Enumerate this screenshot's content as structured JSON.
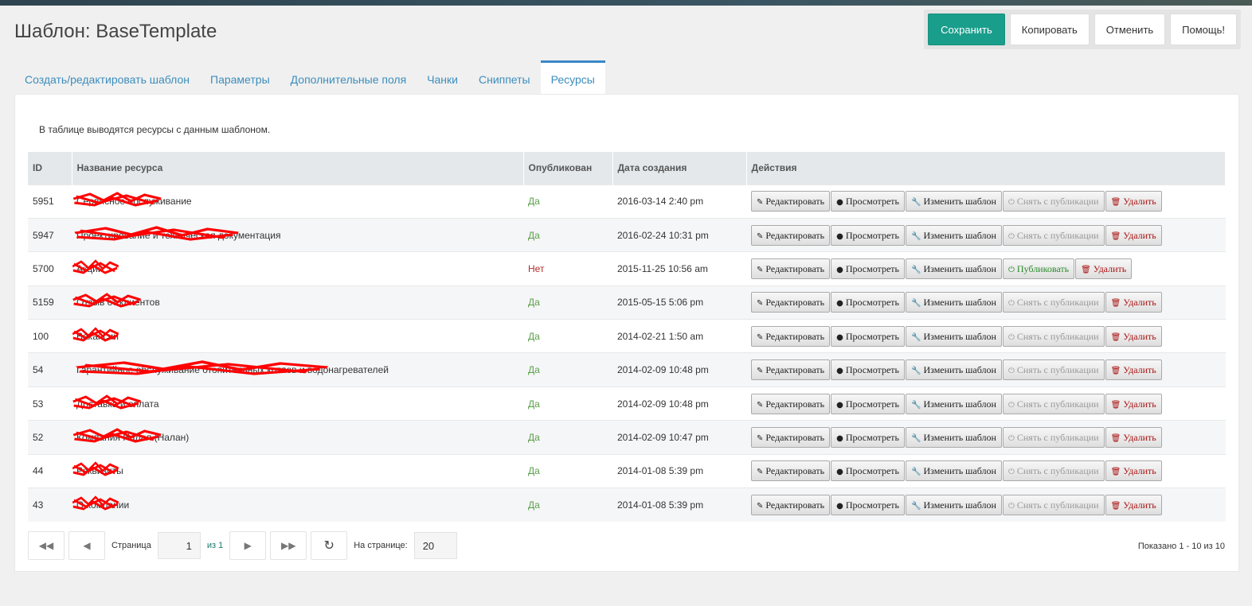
{
  "title": "Шаблон: BaseTemplate",
  "actions": {
    "save": "Сохранить",
    "copy": "Копировать",
    "cancel": "Отменить",
    "help": "Помощь!"
  },
  "tabs": [
    "Создать/редактировать шаблон",
    "Параметры",
    "Дополнительные поля",
    "Чанки",
    "Сниппеты",
    "Ресурсы"
  ],
  "description": "В таблице выводятся ресурсы с данным шаблоном.",
  "columns": [
    "ID",
    "Название ресурса",
    "Опубликован",
    "Дата создания",
    "Действия"
  ],
  "buttons": {
    "edit": "Редактировать",
    "view": "Просмотреть",
    "change": "Изменить шаблон",
    "unpublish": "Снять с публикации",
    "publish": "Публиковать",
    "delete": "Удалить"
  },
  "rows": [
    {
      "id": "5951",
      "name": "Сервисное обслуживание",
      "published": "Да",
      "date": "2016-03-14 2:40 pm"
    },
    {
      "id": "5947",
      "name": "Проектирование и техническая документация",
      "published": "Да",
      "date": "2016-02-24 10:31 pm"
    },
    {
      "id": "5700",
      "name": "Акции",
      "published": "Нет",
      "date": "2015-11-25 10:56 am"
    },
    {
      "id": "5159",
      "name": "Отзыв от клиентов",
      "published": "Да",
      "date": "2015-05-15 5:06 pm"
    },
    {
      "id": "100",
      "name": "Вакансии",
      "published": "Да",
      "date": "2014-02-21 1:50 am"
    },
    {
      "id": "54",
      "name": "Гарантийное обслуживание отопительных котлов и водонагревателей",
      "published": "Да",
      "date": "2014-02-09 10:48 pm"
    },
    {
      "id": "53",
      "name": "Доставка и оплата",
      "published": "Да",
      "date": "2014-02-09 10:48 pm"
    },
    {
      "id": "52",
      "name": "Компания Налал (Налан)",
      "published": "Да",
      "date": "2014-02-09 10:47 pm"
    },
    {
      "id": "44",
      "name": "Реквизиты",
      "published": "Да",
      "date": "2014-01-08 5:39 pm"
    },
    {
      "id": "43",
      "name": "О компании",
      "published": "Да",
      "date": "2014-01-08 5:39 pm"
    }
  ],
  "pager": {
    "page_label": "Страница",
    "page": "1",
    "of": "из 1",
    "per_page_label": "На странице:",
    "per_page": "20",
    "shown": "Показано 1 - 10 из 10"
  }
}
